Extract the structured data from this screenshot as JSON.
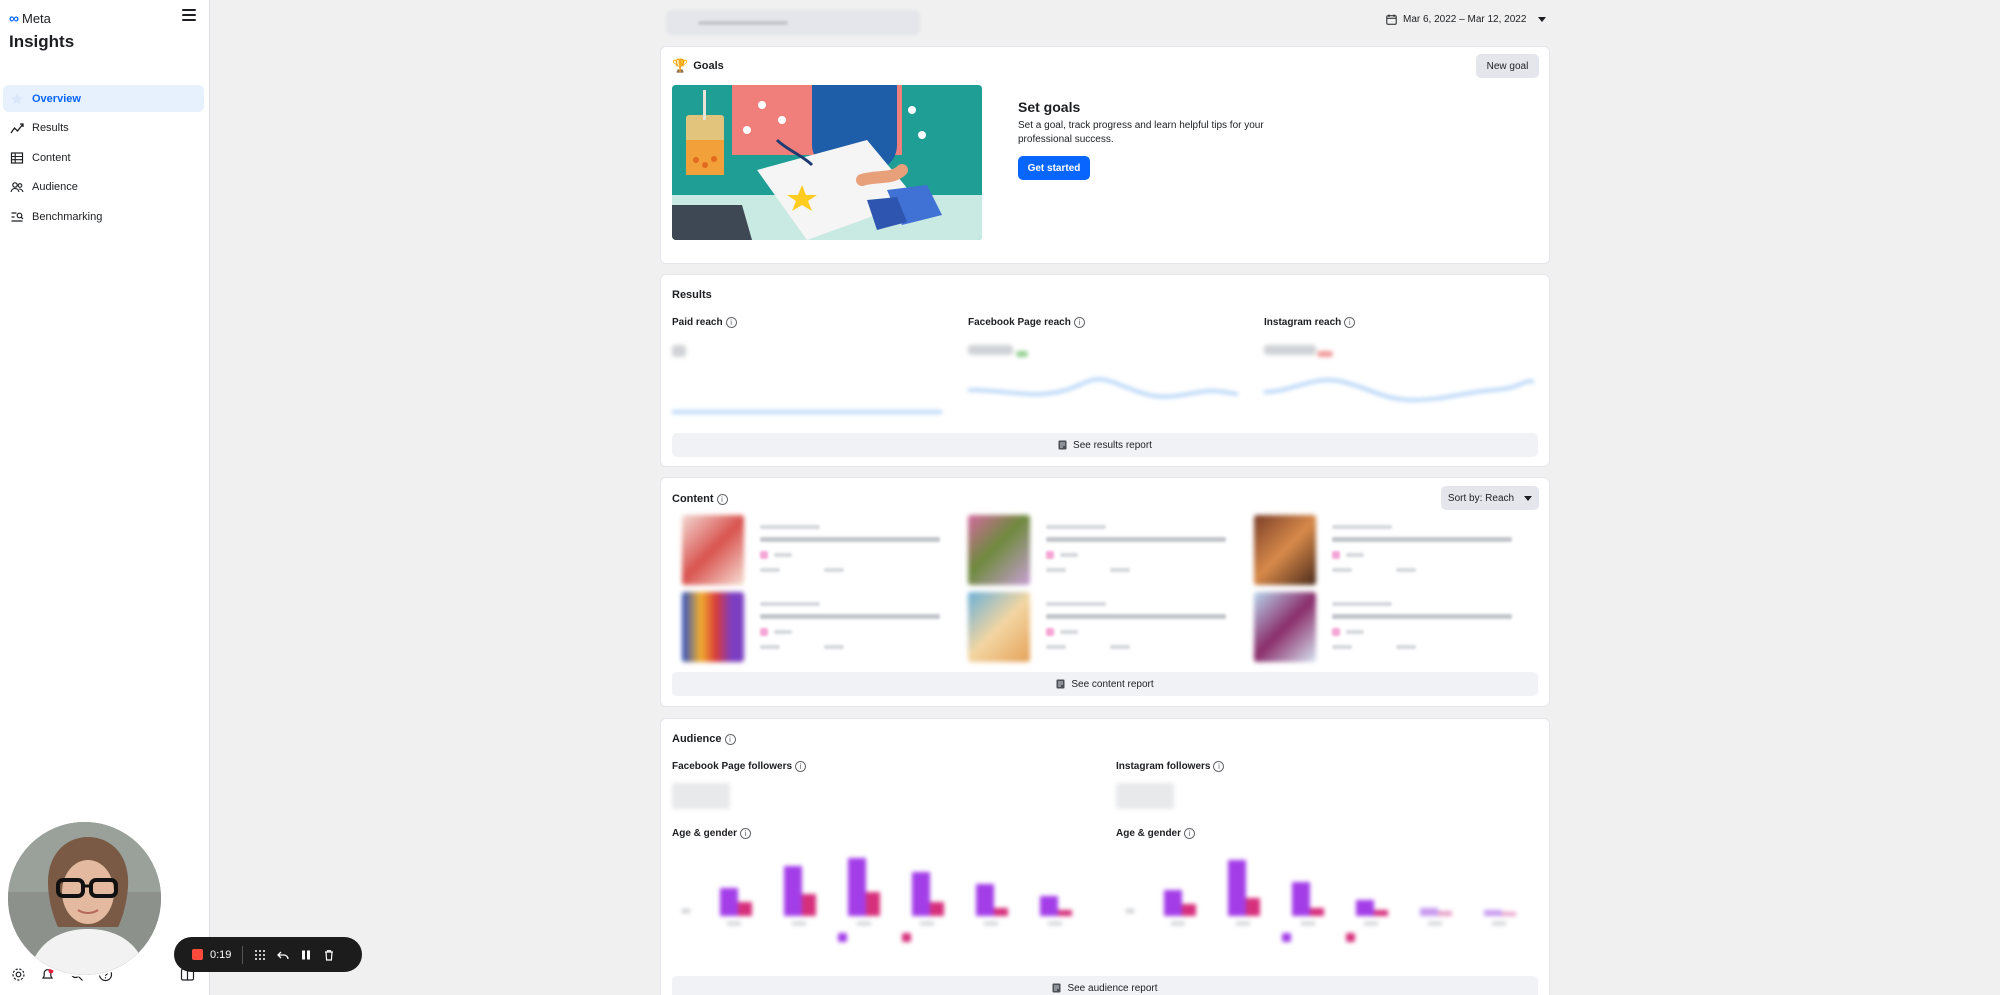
{
  "brand": {
    "logo": "∞",
    "name": "Meta"
  },
  "app_title": "Insights",
  "sidebar": {
    "items": [
      {
        "label": "Overview",
        "icon": "star-icon",
        "active": true
      },
      {
        "label": "Results",
        "icon": "trend-line-icon"
      },
      {
        "label": "Content",
        "icon": "table-icon"
      },
      {
        "label": "Audience",
        "icon": "people-icon"
      },
      {
        "label": "Benchmarking",
        "icon": "benchmark-icon"
      }
    ]
  },
  "topbar": {
    "date_range": "Mar 6, 2022 – Mar 12, 2022"
  },
  "goals": {
    "title": "Goals",
    "new_goal_label": "New goal",
    "heading": "Set goals",
    "description": "Set a goal, track progress and learn helpful tips for your professional success.",
    "cta_label": "Get started"
  },
  "results": {
    "title": "Results",
    "metrics": [
      {
        "label": "Paid reach"
      },
      {
        "label": "Facebook Page reach"
      },
      {
        "label": "Instagram reach"
      }
    ],
    "report_label": "See results report"
  },
  "content": {
    "title": "Content",
    "sort_label": "Sort by: Reach",
    "report_label": "See content report"
  },
  "audience": {
    "title": "Audience",
    "fb_followers_label": "Facebook Page followers",
    "ig_followers_label": "Instagram followers",
    "age_gender_label": "Age & gender",
    "report_label": "See audience report"
  },
  "recorder": {
    "time": "0:19"
  },
  "colors": {
    "accent": "#0866ff",
    "record": "#ff4a3d",
    "audience_purple": "#a33de8",
    "audience_pink": "#d6307c"
  }
}
